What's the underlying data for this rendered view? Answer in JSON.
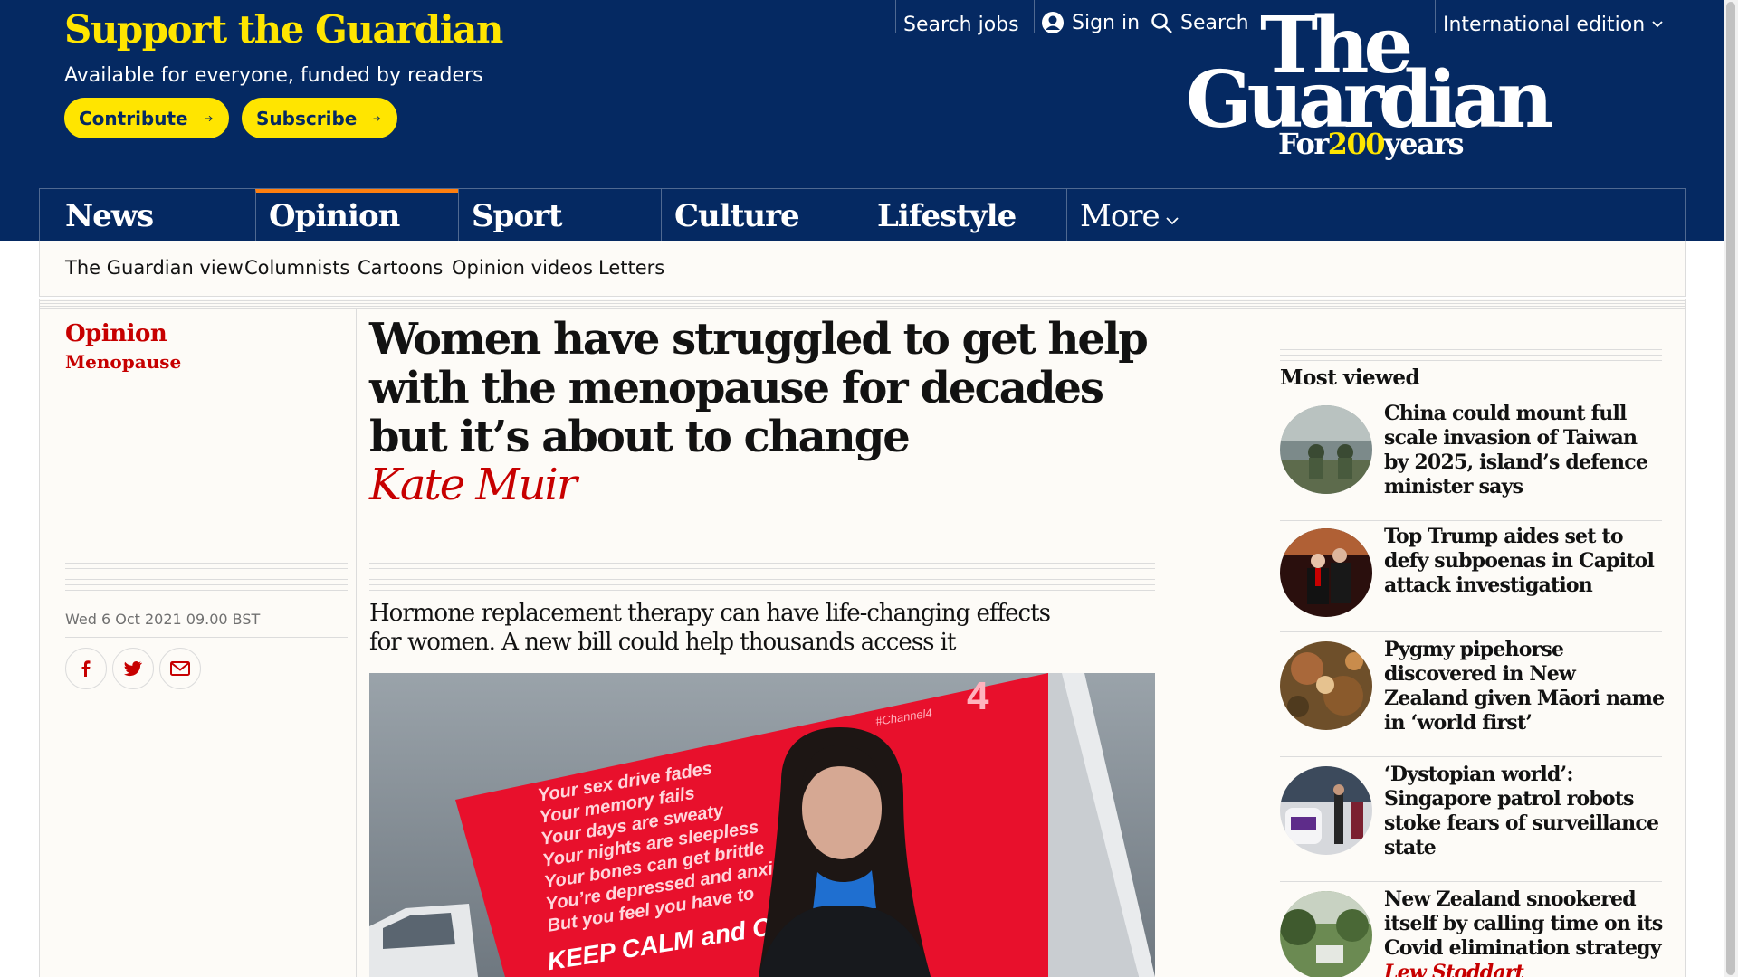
{
  "header": {
    "support_title": "Support the Guardian",
    "support_sub": "Available for everyone, funded by readers",
    "contribute": "Contribute",
    "subscribe": "Subscribe",
    "search_jobs": "Search jobs",
    "sign_in": "Sign in",
    "search": "Search",
    "edition": "International edition",
    "logo": {
      "the": "The",
      "guardian": "Guardian",
      "for": "For",
      "years_num": "200",
      "years": "years"
    }
  },
  "nav": {
    "pillars": [
      "News",
      "Opinion",
      "Sport",
      "Culture",
      "Lifestyle"
    ],
    "active": "Opinion",
    "more": "More"
  },
  "subnav": [
    "The Guardian view",
    "Columnists",
    "Cartoons",
    "Opinion videos",
    "Letters"
  ],
  "article": {
    "section": "Opinion",
    "series": "Menopause",
    "headline": "Women have struggled to get help with the menopause for decades but it’s about to change",
    "byline": "Kate Muir",
    "dateline": "Wed 6 Oct 2021 09.00 BST",
    "standfirst": "Hormone replacement therapy can have life-changing effects for women. A new bill could help thousands access it",
    "share": [
      "facebook-icon",
      "twitter-icon",
      "email-icon"
    ],
    "hero_image": {
      "billboard_hashtag": "#Channel4",
      "billboard_logo": "4",
      "billboard_lines": [
        "Your sex drive fades",
        "Your memory fails",
        "Your days are sweaty",
        "Your nights are sleepless",
        "Your bones can get brittle",
        "You’re depressed and anxious",
        "But you feel you have to"
      ],
      "billboard_slogan": "KEEP CALM and CARRY ON"
    }
  },
  "most_viewed": {
    "title": "Most viewed",
    "items": [
      {
        "headline": "China could mount full scale invasion of Taiwan by 2025, island’s defence minister says",
        "byline": ""
      },
      {
        "headline": "Top Trump aides set to defy subpoenas in Capitol attack investigation",
        "byline": ""
      },
      {
        "headline": "Pygmy pipehorse discovered in New Zealand given Māori name in ‘world first’",
        "byline": ""
      },
      {
        "headline": "‘Dystopian world’: Singapore patrol robots stoke fears of surveillance state",
        "byline": ""
      },
      {
        "headline": "New Zealand snookered itself by calling time on its Covid elimination strategy",
        "byline": "Lew Stoddart"
      }
    ]
  },
  "colors": {
    "brand": "#052962",
    "yellow": "#ffe500",
    "opinion": "#c70000",
    "opinion_accent": "#ff7f0f",
    "background": "#fdfbf7"
  }
}
